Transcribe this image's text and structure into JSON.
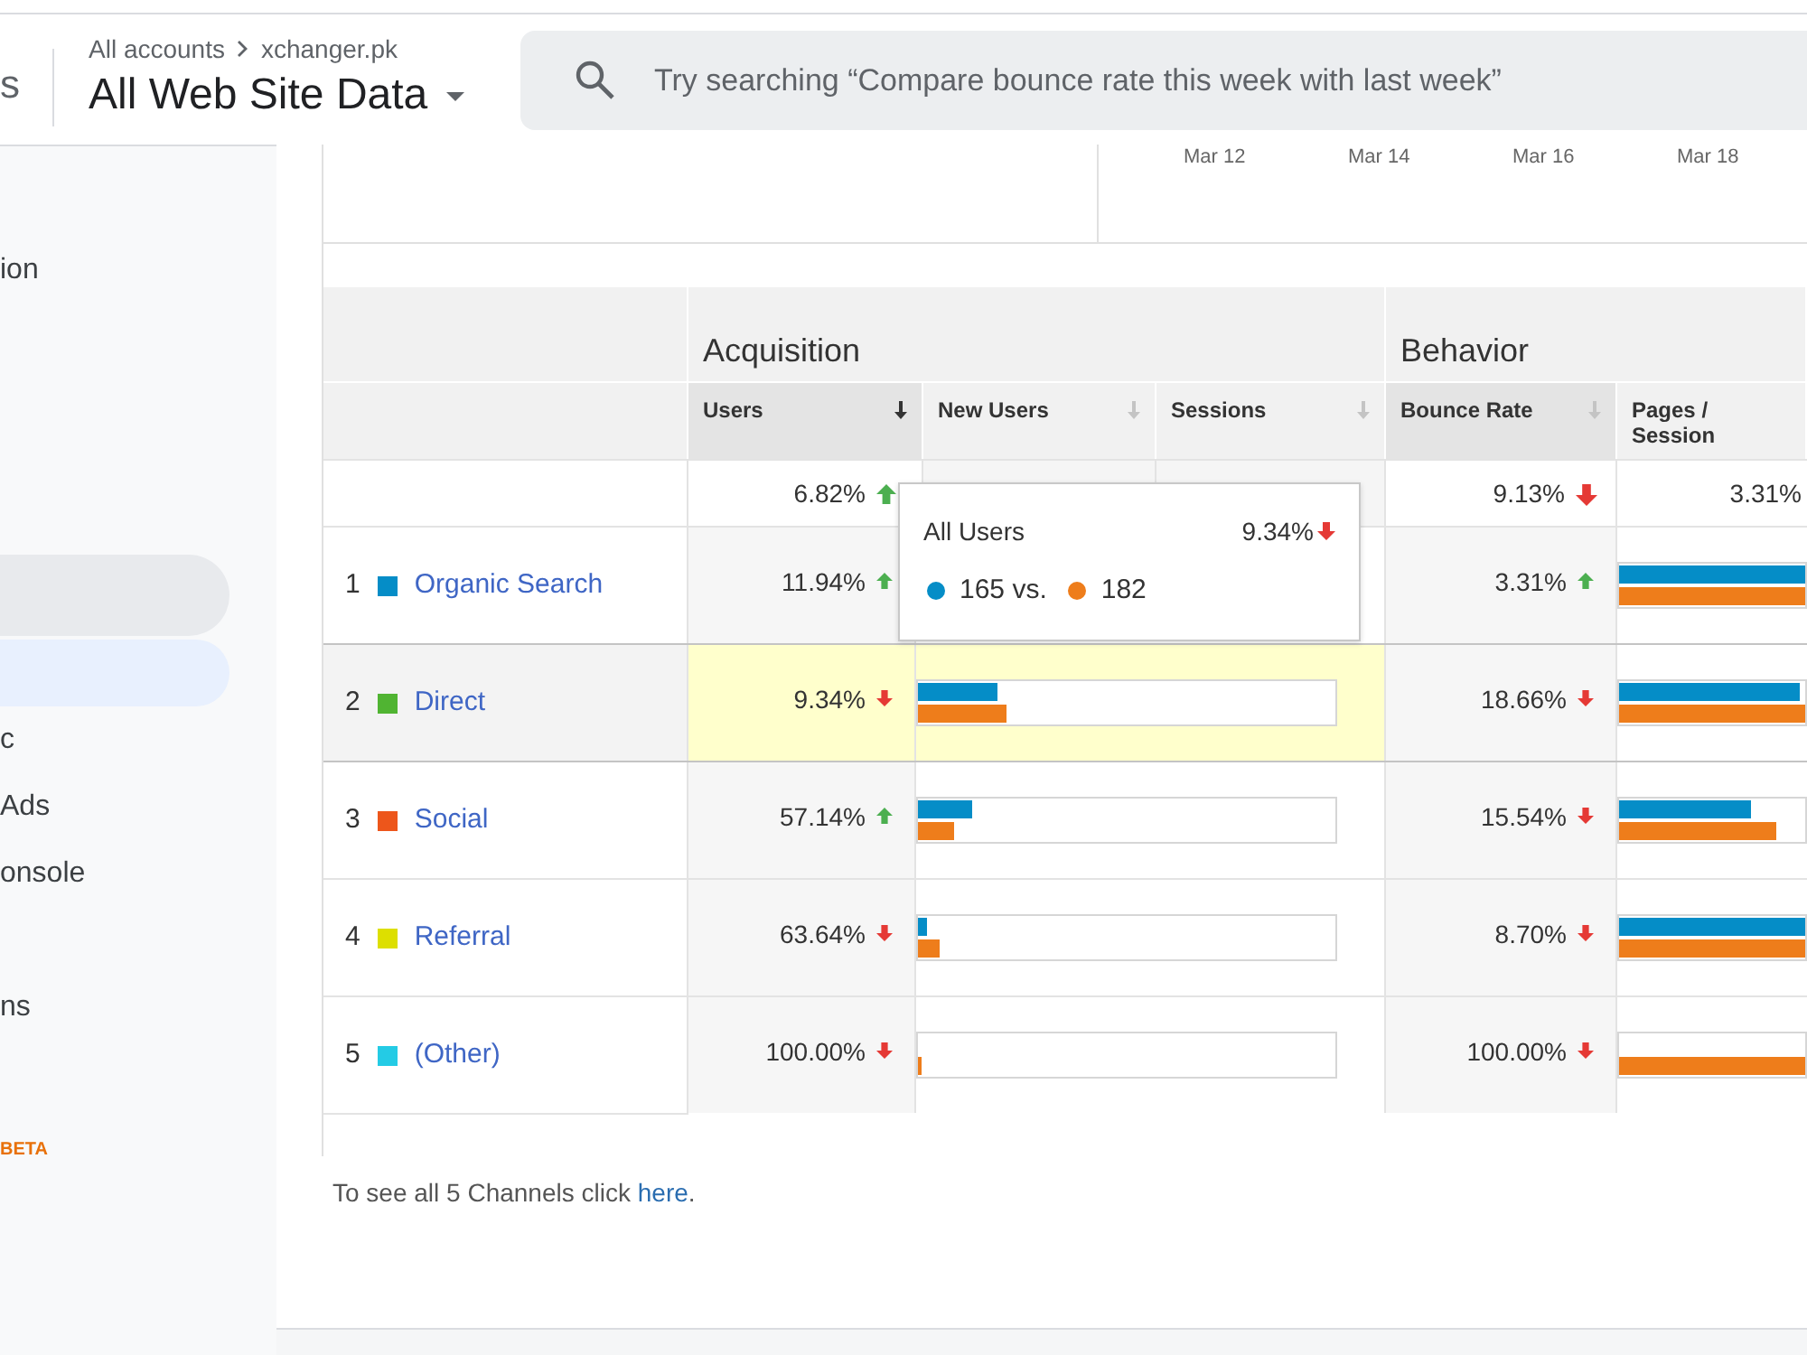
{
  "header": {
    "app_title": "s",
    "breadcrumb": [
      "All accounts",
      "xchanger.pk"
    ],
    "view": "All Web Site Data"
  },
  "search": {
    "placeholder": "Try searching “Compare bounce rate this week with last week”"
  },
  "sidebar": {
    "items": [
      {
        "label": "ion",
        "selected": false,
        "hovered": false
      },
      {
        "selected": false,
        "hovered": true
      },
      {
        "selected": true,
        "hovered": false
      },
      {
        "label": "c",
        "selected": false,
        "hovered": false
      },
      {
        "label": "Ads",
        "selected": false,
        "hovered": false
      },
      {
        "label": "onsole",
        "selected": false,
        "hovered": false
      },
      {
        "label": "ns",
        "selected": false,
        "hovered": false
      }
    ],
    "badge": "BETA"
  },
  "chart_axis_labels": [
    "Mar 12",
    "Mar 14",
    "Mar 16",
    "Mar 18"
  ],
  "table": {
    "groups": [
      "Acquisition",
      "Behavior"
    ],
    "columns": [
      {
        "label": "Users",
        "sorted": true,
        "emphasized": true
      },
      {
        "label": "New Users",
        "sorted": false,
        "emphasized": false
      },
      {
        "label": "Sessions",
        "sorted": false,
        "emphasized": false
      },
      {
        "label": "Bounce Rate",
        "sorted": false,
        "emphasized": true
      },
      {
        "label": "Pages / Session",
        "emphasized": false
      }
    ],
    "totals": {
      "users": {
        "value": "6.82%",
        "trend_up": true
      },
      "bounce_rate": {
        "value": "9.13%",
        "trend_up": false
      },
      "pages_per_session": {
        "value": "3.31%"
      }
    },
    "rows": [
      {
        "rank": "1",
        "channel": "Organic Search",
        "color": "#058dc7",
        "highlighted": false,
        "users": {
          "value": "11.94%",
          "trend_up": true
        },
        "bounce_rate": {
          "value": "3.31%",
          "trend_up": true
        },
        "pages_bars": {
          "first": {
            "level": 1
          },
          "second": {
            "level": 1
          }
        }
      },
      {
        "rank": "2",
        "channel": "Direct",
        "color": "#50b432",
        "highlighted": true,
        "users": {
          "value": "9.34%",
          "trend_up": false
        },
        "users_bars": {
          "first": {
            "level": 0.19
          },
          "second": {
            "level": 0.21
          }
        },
        "bounce_rate": {
          "value": "18.66%",
          "trend_up": false
        },
        "pages_bars": {
          "first": {
            "level": 0.97
          },
          "second": {
            "level": 1
          }
        }
      },
      {
        "rank": "3",
        "channel": "Social",
        "color": "#ed561b",
        "highlighted": false,
        "users": {
          "value": "57.14%",
          "trend_up": true
        },
        "users_bars": {
          "first": {
            "level": 0.13
          },
          "second": {
            "level": 0.085
          }
        },
        "bounce_rate": {
          "value": "15.54%",
          "trend_up": false
        },
        "pages_bars": {
          "first": {
            "level": 0.71
          },
          "second": {
            "level": 0.84
          }
        }
      },
      {
        "rank": "4",
        "channel": "Referral",
        "color": "#dddf00",
        "highlighted": false,
        "users": {
          "value": "63.64%",
          "trend_up": false
        },
        "users_bars": {
          "first": {
            "level": 0.02
          },
          "second": {
            "level": 0.05
          }
        },
        "bounce_rate": {
          "value": "8.70%",
          "trend_up": false
        },
        "pages_bars": {
          "first": {
            "level": 1
          },
          "second": {
            "level": 1
          }
        }
      },
      {
        "rank": "5",
        "channel": "(Other)",
        "color": "#24cbe5",
        "highlighted": false,
        "users": {
          "value": "100.00%",
          "trend_up": false
        },
        "users_bars": {
          "second": {
            "level": 0.01
          }
        },
        "bounce_rate": {
          "value": "100.00%",
          "trend_up": false
        },
        "pages_bars": {
          "second": {
            "level": 1
          }
        }
      }
    ]
  },
  "tooltip": {
    "title": "All Users",
    "value": "9.34%",
    "trend_up": false,
    "legend": [
      {
        "label": "165 vs.",
        "color": "#058dc7"
      },
      {
        "label": "182",
        "color": "#ee7d1b"
      }
    ]
  },
  "footer_note": {
    "before": "To see all 5 Channels click ",
    "link": "here",
    "after": "."
  }
}
